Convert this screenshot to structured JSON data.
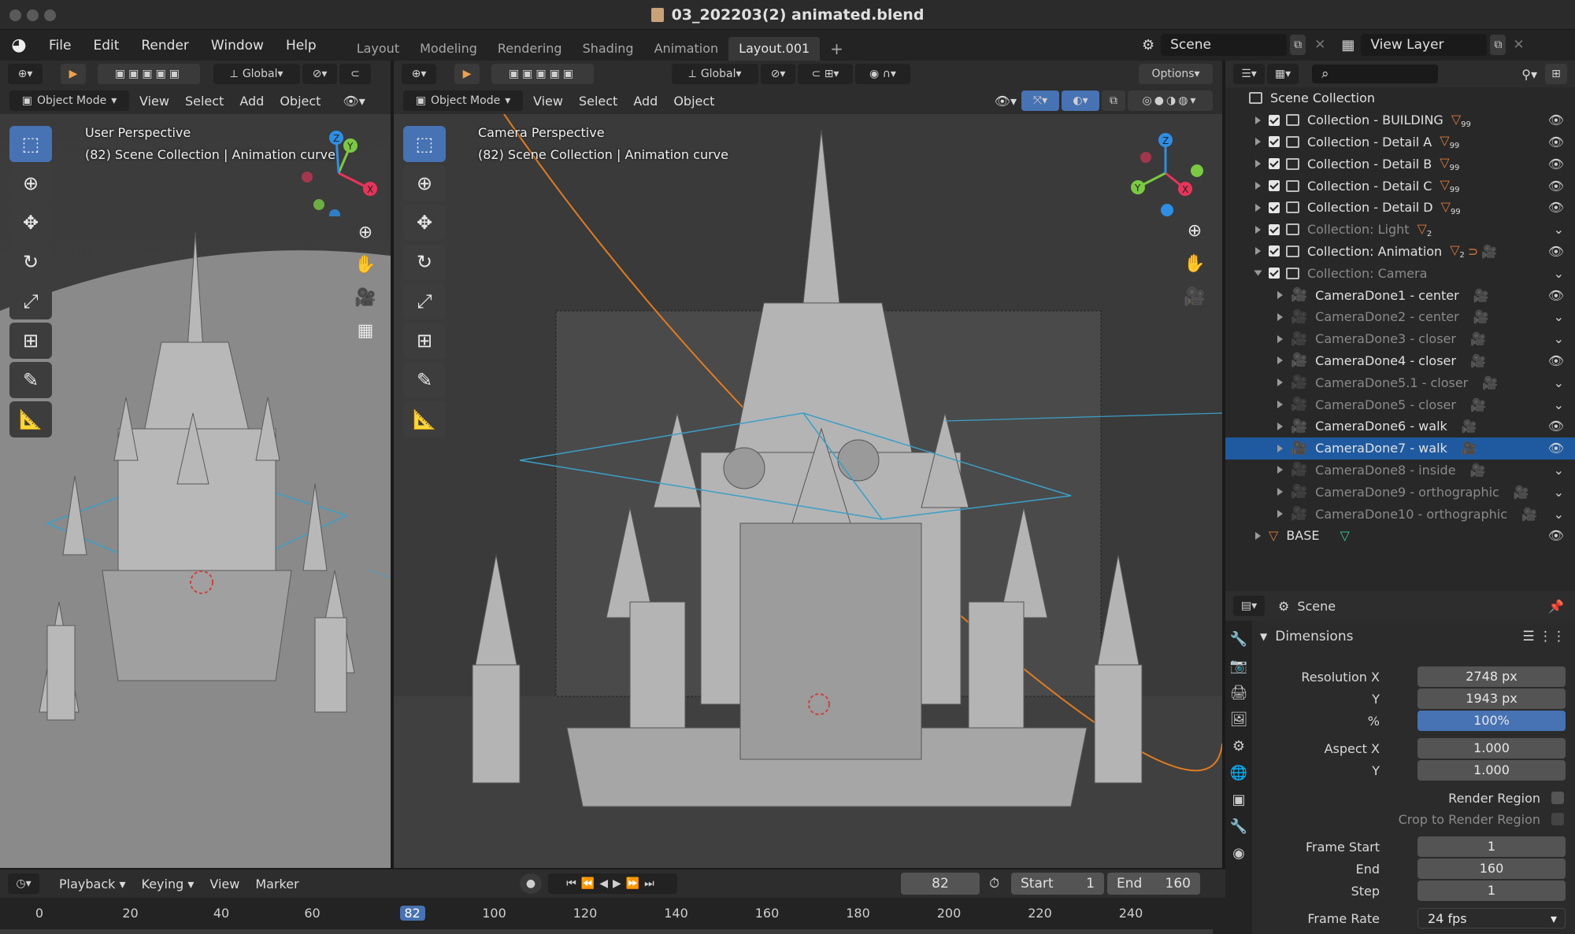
{
  "window": {
    "title": "03_202203(2) animated.blend"
  },
  "menu": {
    "items": [
      "File",
      "Edit",
      "Render",
      "Window",
      "Help"
    ]
  },
  "workspaces": {
    "tabs": [
      "Layout",
      "Modeling",
      "Rendering",
      "Shading",
      "Animation",
      "Layout.001"
    ],
    "active": "Layout.001",
    "add": "+"
  },
  "scene": {
    "name": "Scene",
    "view_layer": "View Layer"
  },
  "left_view": {
    "header": {
      "orientation": "Global",
      "mode": "Object Mode",
      "menus": [
        "View",
        "Select",
        "Add",
        "Object"
      ]
    },
    "overlay": {
      "line1": "User Perspective",
      "line2": "(82) Scene Collection | Animation curve"
    }
  },
  "main_view": {
    "header": {
      "orientation": "Global",
      "mode": "Object Mode",
      "menus": [
        "View",
        "Select",
        "Add",
        "Object"
      ],
      "options": "Options"
    },
    "overlay": {
      "line1": "Camera Perspective",
      "line2": "(82) Scene Collection | Animation curve"
    }
  },
  "gizmo": {
    "x": "X",
    "y": "Y",
    "z": "Z"
  },
  "outliner": {
    "root": "Scene Collection",
    "items": [
      {
        "label": "Collection - BUILDING",
        "badge": "99",
        "dim": false
      },
      {
        "label": "Collection - Detail A",
        "badge": "99",
        "dim": false
      },
      {
        "label": "Collection - Detail B",
        "badge": "99",
        "dim": false
      },
      {
        "label": "Collection - Detail C",
        "badge": "99",
        "dim": false
      },
      {
        "label": "Collection - Detail D",
        "badge": "99",
        "dim": false
      },
      {
        "label": "Collection: Light",
        "badge": "2",
        "dim": true
      },
      {
        "label": "Collection: Animation",
        "badge": "2",
        "dim": false
      },
      {
        "label": "Collection: Camera",
        "badge": "",
        "dim": true
      }
    ],
    "cameras": [
      {
        "label": "CameraDone1 - center",
        "dim": false,
        "selected": false
      },
      {
        "label": "CameraDone2 - center",
        "dim": true,
        "selected": false
      },
      {
        "label": "CameraDone3 - closer",
        "dim": true,
        "selected": false
      },
      {
        "label": "CameraDone4 - closer",
        "dim": false,
        "selected": false
      },
      {
        "label": "CameraDone5.1 - closer",
        "dim": true,
        "selected": false
      },
      {
        "label": "CameraDone5 - closer",
        "dim": true,
        "selected": false
      },
      {
        "label": "CameraDone6 - walk",
        "dim": false,
        "selected": false
      },
      {
        "label": "CameraDone7 - walk",
        "dim": false,
        "selected": true
      },
      {
        "label": "CameraDone8 - inside",
        "dim": true,
        "selected": false
      },
      {
        "label": "CameraDone9 - orthographic",
        "dim": true,
        "selected": false
      },
      {
        "label": "CameraDone10 - orthographic",
        "dim": true,
        "selected": false
      }
    ],
    "base": "BASE"
  },
  "properties": {
    "context": "Scene",
    "panel": "Dimensions",
    "resolution_x_label": "Resolution X",
    "resolution_x": "2748 px",
    "resolution_y_label": "Y",
    "resolution_y": "1943 px",
    "percent_label": "%",
    "percent": "100%",
    "aspect_x_label": "Aspect X",
    "aspect_x": "1.000",
    "aspect_y_label": "Y",
    "aspect_y": "1.000",
    "render_region": "Render Region",
    "crop_region": "Crop to Render Region",
    "frame_start_label": "Frame Start",
    "frame_start": "1",
    "end_label": "End",
    "end": "160",
    "step_label": "Step",
    "step": "1",
    "frame_rate_label": "Frame Rate",
    "frame_rate": "24 fps"
  },
  "timeline": {
    "menus": [
      "Playback",
      "Keying",
      "View",
      "Marker"
    ],
    "current_frame": "82",
    "start_label": "Start",
    "start": "1",
    "end_label": "End",
    "end": "160",
    "ticks": [
      "0",
      "20",
      "40",
      "60",
      "82",
      "100",
      "120",
      "140",
      "160",
      "180",
      "200",
      "220",
      "240"
    ]
  }
}
